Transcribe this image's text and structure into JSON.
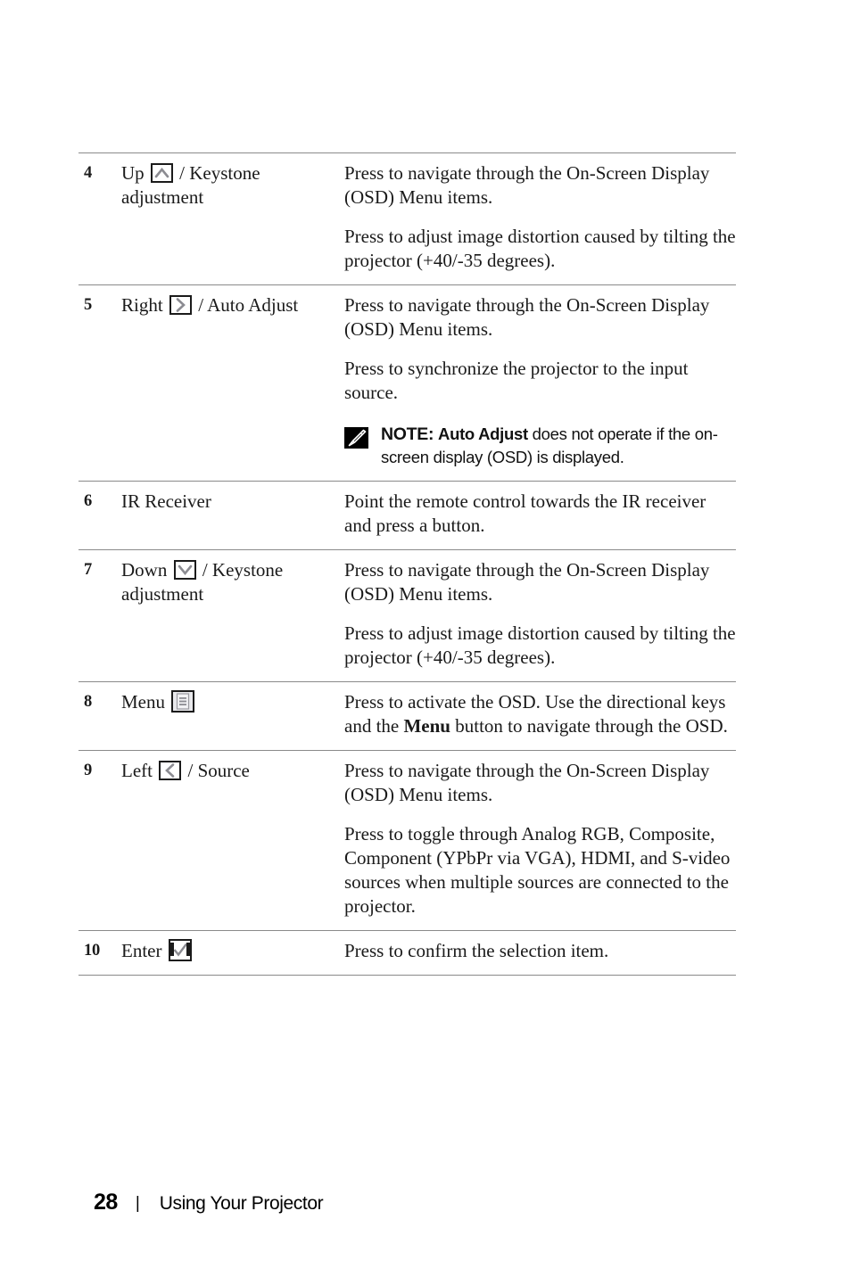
{
  "document": {
    "footer": {
      "page_number": "28",
      "separator": "|",
      "title": "Using Your Projector"
    }
  },
  "table": {
    "rows": [
      {
        "num": "4",
        "name_pre": "Up",
        "icon": "up-arrow-key-icon",
        "name_post": "/ Keystone adjustment",
        "paragraphs": [
          "Press to navigate through the On-Screen Display (OSD) Menu items.",
          "Press to adjust image distortion caused by tilting the projector (+40/-35 degrees)."
        ]
      },
      {
        "num": "5",
        "name_pre": "Right",
        "icon": "right-arrow-key-icon",
        "name_post": "/ Auto Adjust",
        "paragraphs": [
          "Press to navigate through the On-Screen Display (OSD) Menu items.",
          "Press to synchronize the projector to the input source."
        ],
        "note": {
          "icon": "note-pencil-icon",
          "lead": "NOTE:",
          "bold_term": "Auto Adjust",
          "rest": " does not operate if the on-screen display (OSD) is displayed."
        }
      },
      {
        "num": "6",
        "name_pre": "IR Receiver",
        "icon": "",
        "name_post": "",
        "paragraphs": [
          "Point the remote control towards the IR receiver and press a button."
        ]
      },
      {
        "num": "7",
        "name_pre": "Down",
        "icon": "down-arrow-key-icon",
        "name_post": "/ Keystone adjustment",
        "paragraphs": [
          "Press to navigate through the On-Screen Display (OSD) Menu items.",
          "Press to adjust image distortion caused by tilting the projector (+40/-35 degrees)."
        ]
      },
      {
        "num": "8",
        "name_pre": "Menu",
        "icon": "menu-key-icon",
        "name_post": "",
        "desc_pre": "Press to activate the OSD. Use the directional keys and the ",
        "desc_bold": "Menu",
        "desc_post": " button to navigate through the OSD.",
        "paragraphs": []
      },
      {
        "num": "9",
        "name_pre": "Left",
        "icon": "left-arrow-key-icon",
        "name_post": "/ Source",
        "paragraphs": [
          "Press to navigate through the On-Screen Display (OSD) Menu items.",
          "Press to toggle through Analog RGB, Composite, Component (YPbPr via VGA), HDMI, and S-video sources when multiple sources are connected to the projector."
        ]
      },
      {
        "num": "10",
        "name_pre": "Enter",
        "icon": "enter-key-icon",
        "name_post": "",
        "paragraphs": [
          "Press to confirm the selection item."
        ]
      }
    ]
  },
  "colors": {
    "rule": "#8a8a8a",
    "text": "#1a1a1a",
    "icon_border": "#1b1b1b",
    "icon_glyph": "#8c8c92",
    "note_icon_bg": "#000000"
  }
}
